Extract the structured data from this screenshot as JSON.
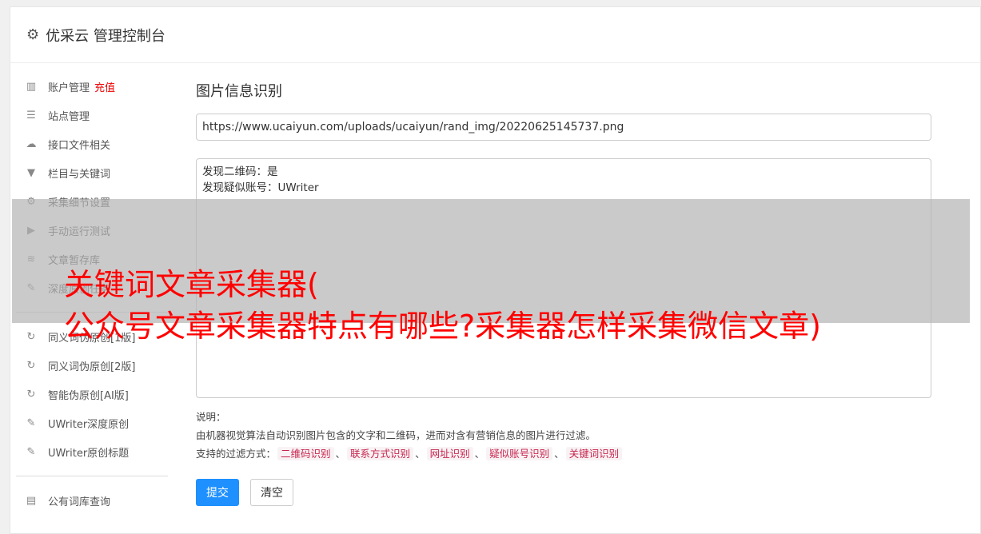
{
  "header": {
    "title": "优采云 管理控制台",
    "icon": "gear-icon"
  },
  "sidebar": {
    "items": [
      {
        "label": "账户管理",
        "extra": "充值",
        "icon": "bar-chart-icon"
      },
      {
        "label": "站点管理",
        "icon": "server-icon"
      },
      {
        "label": "接口文件相关",
        "icon": "cloud-upload-icon"
      },
      {
        "label": "栏目与关键词",
        "icon": "filter-icon"
      },
      {
        "label": "采集细节设置",
        "icon": "gears-icon"
      },
      {
        "label": "手动运行测试",
        "icon": "play-circle-icon"
      },
      {
        "label": "文章暂存库",
        "icon": "database-icon"
      },
      {
        "label": "深度原创任务",
        "icon": "edit-icon"
      },
      {
        "label": "同义词伪原创[1版]",
        "icon": "refresh-icon"
      },
      {
        "label": "同义词伪原创[2版]",
        "icon": "refresh-icon"
      },
      {
        "label": "智能伪原创[AI版]",
        "icon": "refresh-icon"
      },
      {
        "label": "UWriter深度原创",
        "icon": "edit-icon"
      },
      {
        "label": "UWriter原创标题",
        "icon": "edit-icon"
      },
      {
        "label": "公有词库查询",
        "icon": "book-icon"
      }
    ]
  },
  "main": {
    "title": "图片信息识别",
    "url": "https://www.ucaiyun.com/uploads/ucaiyun/rand_img/20220625145737.png",
    "result": "发现二维码：是\n发现疑似账号：UWriter",
    "note_label": "说明：",
    "note_text": "由机器视觉算法自动识别图片包含的文字和二维码，进而对含有营销信息的图片进行过滤。",
    "filter_label": "支持的过滤方式：",
    "filters": [
      "二维码识别",
      "联系方式识别",
      "网址识别",
      "疑似账号识别",
      "关键词识别"
    ],
    "submit": "提交",
    "clear": "清空"
  },
  "overlay": {
    "line1": "关键词文章采集器(",
    "line2": "公众号文章采集器特点有哪些?采集器怎样采集微信文章)"
  }
}
